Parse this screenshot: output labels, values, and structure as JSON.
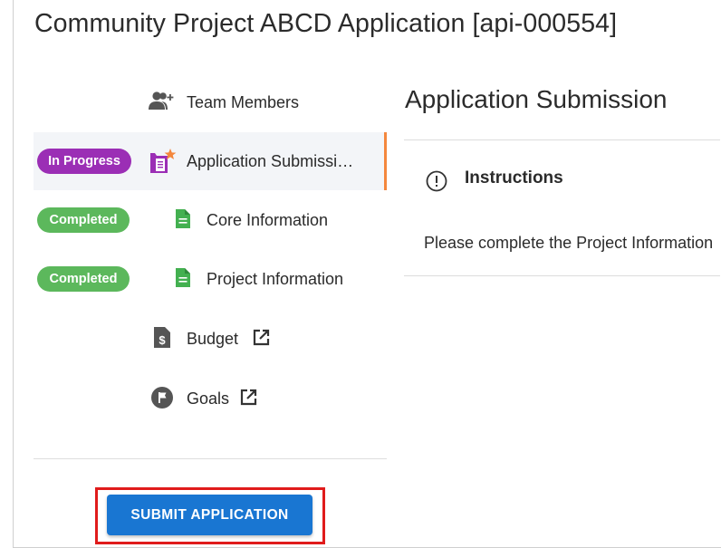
{
  "app": {
    "title": "Community Project ABCD Application [api-000554]"
  },
  "sidebar": {
    "items": [
      {
        "label": "Team Members",
        "icon": "team-members-icon"
      },
      {
        "label": "Application Submissi…",
        "icon": "application-submission-icon",
        "status": "In Progress",
        "active": true
      },
      {
        "label": "Core Information",
        "icon": "document-icon",
        "status": "Completed"
      },
      {
        "label": "Project Information",
        "icon": "document-icon",
        "status": "Completed"
      },
      {
        "label": "Budget",
        "icon": "budget-icon",
        "external": true
      },
      {
        "label": "Goals",
        "icon": "goals-flag-icon",
        "external": true
      }
    ],
    "submit_label": "SUBMIT APPLICATION"
  },
  "main": {
    "title": "Application Submission",
    "instructions_title": "Instructions",
    "instructions_text": "Please complete the Project Information"
  },
  "colors": {
    "in_progress": "#9b2eb5",
    "completed": "#5cb85c",
    "active_indicator": "#f4873d",
    "primary_button": "#1976d2",
    "highlight_outline": "#e01b1b",
    "doc_icon_green": "#43b050"
  }
}
